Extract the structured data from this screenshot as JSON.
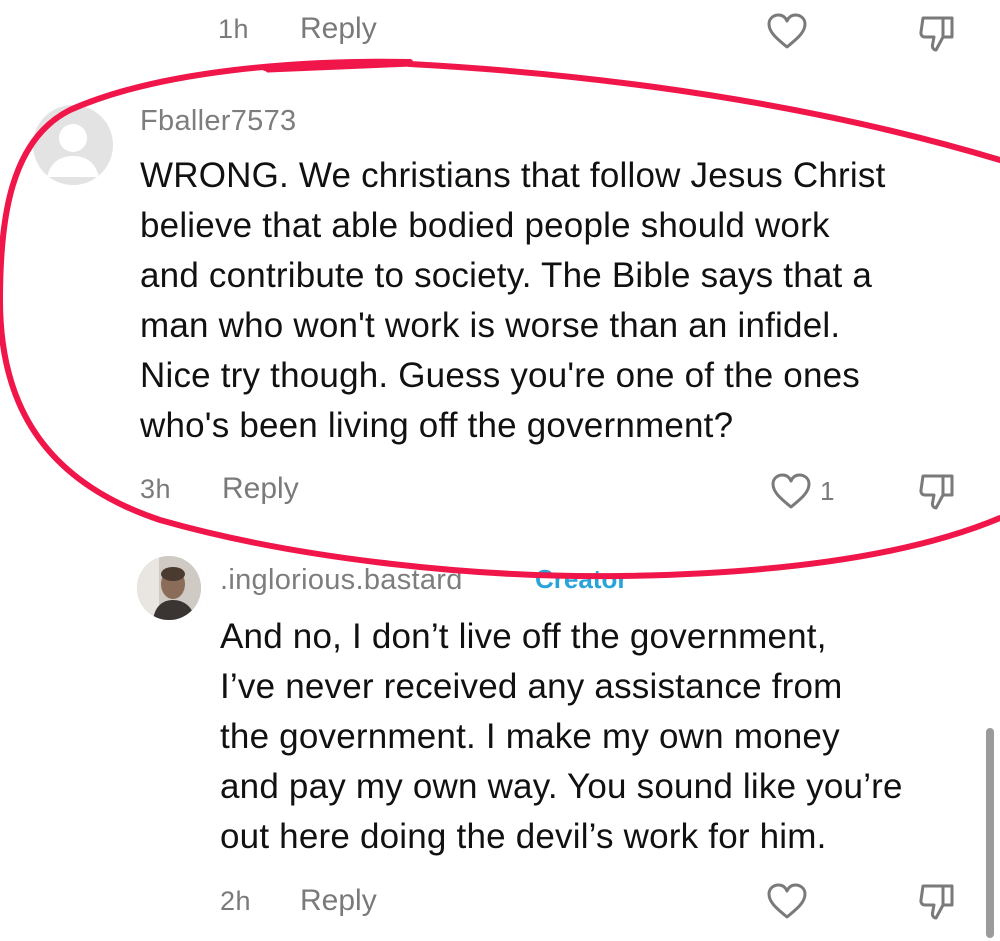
{
  "top_comment_actions": {
    "time": "1h",
    "reply_label": "Reply"
  },
  "highlighted_comment": {
    "username": "Fballer7573",
    "text": "WRONG. We christians that follow Jesus Christ believe that able bodied people should work and contribute to society. The Bible says that a man who won't work is worse than an infidel. Nice try though. Guess you're one of the ones who's been living off the government?",
    "lines": [
      "WRONG. We christians that follow Jesus Christ",
      "believe that able bodied people should work",
      "and contribute to society. The Bible says that a",
      "man who won't work is worse than an infidel.",
      "Nice try though. Guess you're one of the ones",
      "who's been living off the government?"
    ],
    "time": "3h",
    "reply_label": "Reply",
    "like_count": "1"
  },
  "reply_comment": {
    "username": ".inglorious.bastard",
    "badge": "Creator",
    "lines": [
      "And no, I don’t live off the government,",
      "I’ve never received any assistance from",
      "the government. I make my own money",
      "and pay my own way. You sound like you’re",
      "out here doing the devil’s work for him."
    ],
    "time": "2h",
    "reply_label": "Reply"
  },
  "colors": {
    "annotation_stroke": "#f0164a",
    "creator_badge": "#2aa4d8",
    "meta_text": "#7a7a7a"
  },
  "icons": [
    "heart-outline-icon",
    "dislike-icon",
    "default-avatar-icon"
  ]
}
